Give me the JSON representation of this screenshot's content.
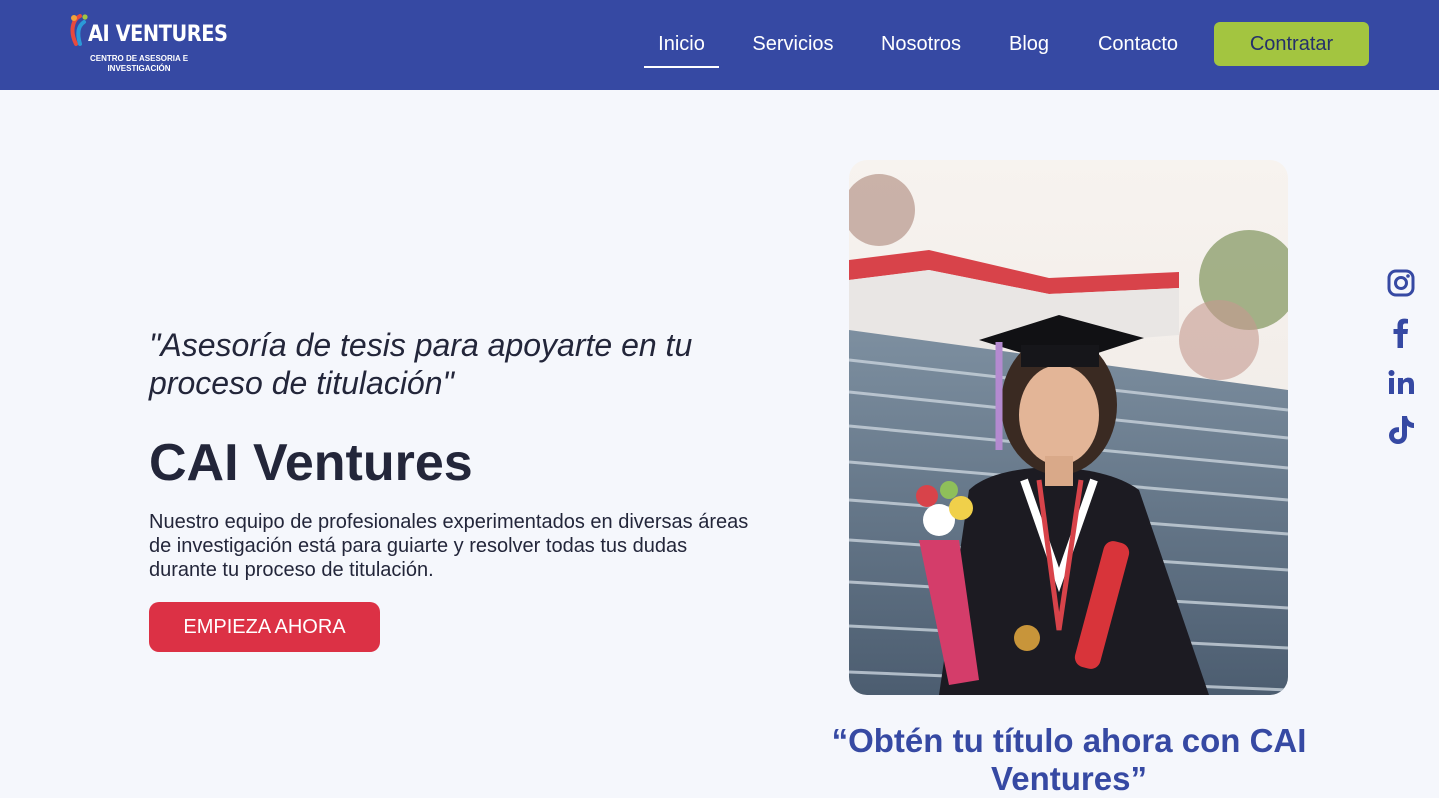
{
  "header": {
    "logo": {
      "title": "AI VENTURES",
      "subtitle_line1": "CENTRO DE ASESORIA E",
      "subtitle_line2": "INVESTIGACIÓN"
    },
    "nav": [
      {
        "label": "Inicio",
        "active": true
      },
      {
        "label": "Servicios",
        "active": false
      },
      {
        "label": "Nosotros",
        "active": false
      },
      {
        "label": "Blog",
        "active": false
      },
      {
        "label": "Contacto",
        "active": false
      }
    ],
    "cta_label": "Contratar"
  },
  "hero": {
    "quote": "\"Asesoría de tesis para apoyarte en tu proceso de titulación\"",
    "title": "CAI Ventures",
    "description": "Nuestro equipo de profesionales experimentados en diversas áreas de investigación está para guiarte y resolver todas tus dudas durante tu proceso de titulación.",
    "button_label": "EMPIEZA AHORA",
    "tagline": "“Obtén tu título ahora con CAI Ventures”"
  },
  "social": [
    {
      "icon": "instagram-icon"
    },
    {
      "icon": "facebook-icon"
    },
    {
      "icon": "linkedin-icon"
    },
    {
      "icon": "tiktok-icon"
    }
  ],
  "colors": {
    "header_bg": "#3649a3",
    "page_bg": "#f5f7fc",
    "accent_green": "#a3c540",
    "accent_red": "#dc3145",
    "text_dark": "#23263a",
    "brand_blue": "#3649a3"
  }
}
